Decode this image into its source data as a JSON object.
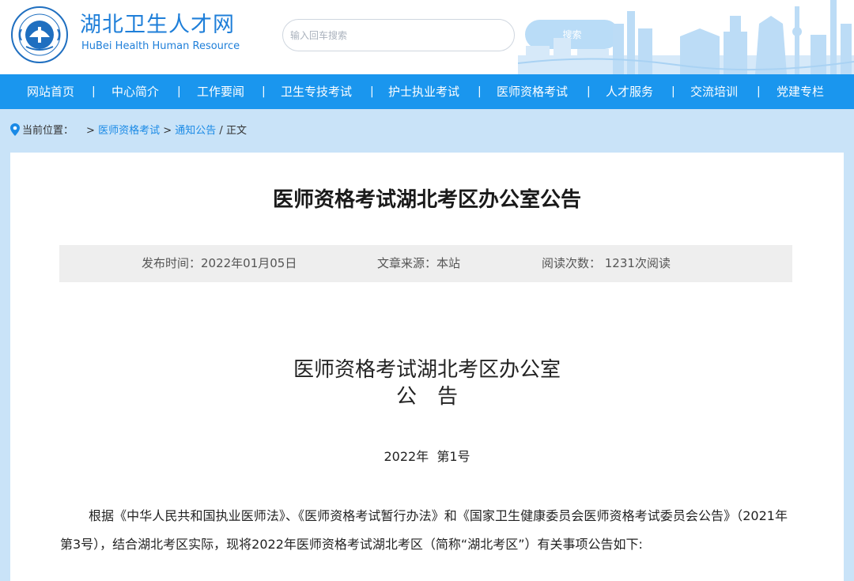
{
  "header": {
    "brand_cn": "湖北卫生人才网",
    "brand_en": "HuBei Health Human Resource",
    "search_placeholder": "输入回车搜索",
    "search_button": "搜索"
  },
  "nav": {
    "items": [
      "网站首页",
      "中心简介",
      "工作要闻",
      "卫生专技考试",
      "护士执业考试",
      "医师资格考试",
      "人才服务",
      "交流培训",
      "党建专栏"
    ],
    "separator": "|"
  },
  "breadcrumb": {
    "label": "当前位置：",
    "arrow1": ">",
    "link1": "医师资格考试",
    "arrow2": ">",
    "link2": "通知公告",
    "slash": "/",
    "current": "正文"
  },
  "article": {
    "title": "医师资格考试湖北考区办公室公告",
    "publish_time": "发布时间：2022年01月05日",
    "source": "文章来源：本站",
    "reads": "阅读次数： 1231次阅读",
    "doc_heading": "医师资格考试湖北考区办公室",
    "doc_sub": "公告",
    "doc_number": "2022年  第1号",
    "body": "根据《中华人民共和国执业医师法》、《医师资格考试暂行办法》和《国家卫生健康委员会医师资格考试委员会公告》（2021年第3号），结合湖北考区实际，现将2022年医师资格考试湖北考区（简称“湖北考区”）有关事项公告如下:"
  },
  "colors": {
    "nav_bg": "#1a96ee",
    "page_bg": "#c9e3f8",
    "brand": "#1f7fd9",
    "link": "#1a8ae6"
  }
}
